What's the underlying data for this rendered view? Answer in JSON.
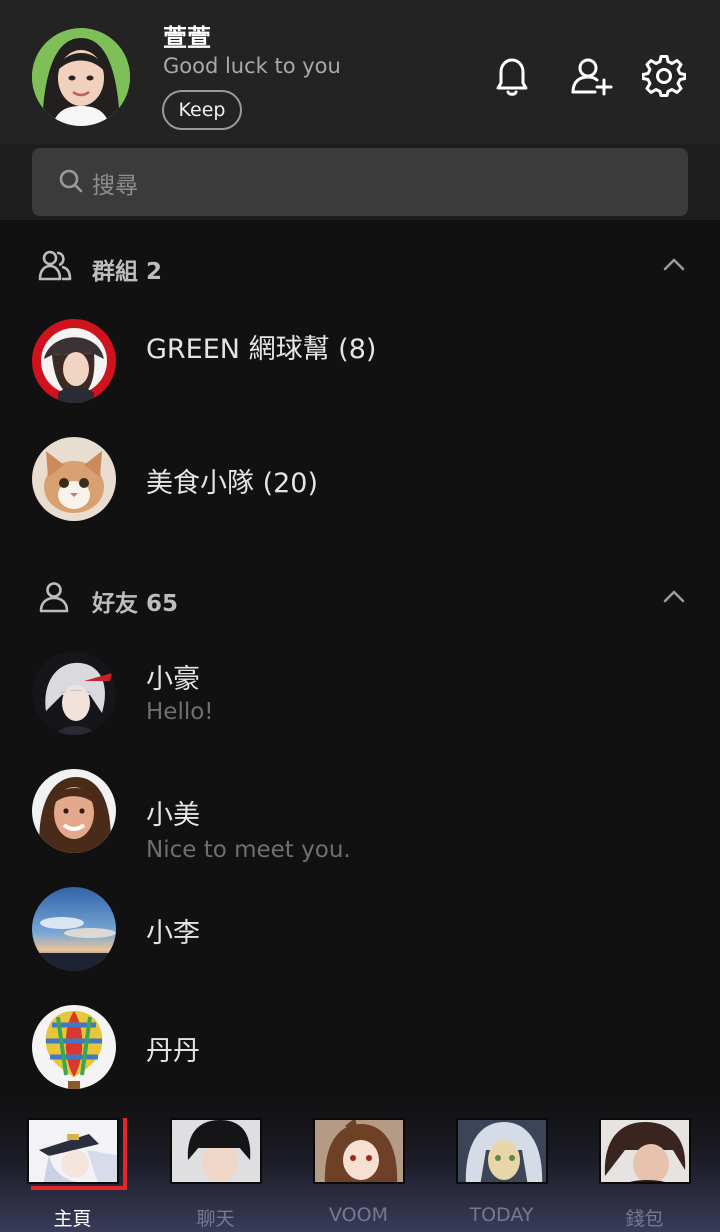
{
  "profile": {
    "name": "萱萱",
    "status_message": "Good luck to you",
    "keep_label": "Keep"
  },
  "header_icons": [
    "bell-icon",
    "add-friend-icon",
    "settings-gear-icon"
  ],
  "search": {
    "placeholder": "搜尋"
  },
  "groups_section": {
    "title": "群組 2",
    "items": [
      {
        "name": "GREEN 網球幫 (8)"
      },
      {
        "name": "美食小隊 (20)"
      }
    ]
  },
  "friends_section": {
    "title": "好友 65",
    "items": [
      {
        "name": "小豪",
        "status": "Hello!"
      },
      {
        "name": "小美",
        "status": "Nice to meet you."
      },
      {
        "name": "小李",
        "status": ""
      },
      {
        "name": "丹丹",
        "status": ""
      }
    ]
  },
  "bottom_nav": {
    "tabs": [
      {
        "label": "主頁",
        "active": true
      },
      {
        "label": "聊天",
        "active": false
      },
      {
        "label": "VOOM",
        "active": false
      },
      {
        "label": "TODAY",
        "active": false
      },
      {
        "label": "錢包",
        "active": false
      }
    ]
  },
  "colors": {
    "background": "#111112",
    "header": "#232324",
    "search_box": "#3b3b3c",
    "active_indicator": "#e3262c",
    "nav_gradient_bottom": "#393b5a"
  }
}
